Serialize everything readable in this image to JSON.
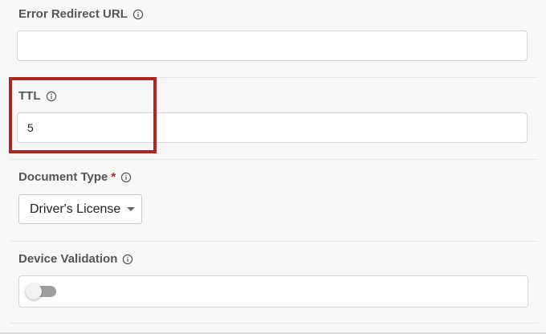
{
  "fields": {
    "error_redirect": {
      "label": "Error Redirect URL",
      "value": ""
    },
    "ttl": {
      "label": "TTL",
      "value": "5"
    },
    "document_type": {
      "label": "Document Type",
      "required_marker": "*",
      "selected": "Driver's License"
    },
    "device_validation": {
      "label": "Device Validation",
      "enabled": false
    }
  },
  "colors": {
    "highlight": "#b0251e",
    "required": "#d0191b",
    "toggle_off_track": "#9e9e9e"
  },
  "icons": {
    "info": "info-circle-icon",
    "dropdown": "caret-down-icon"
  }
}
